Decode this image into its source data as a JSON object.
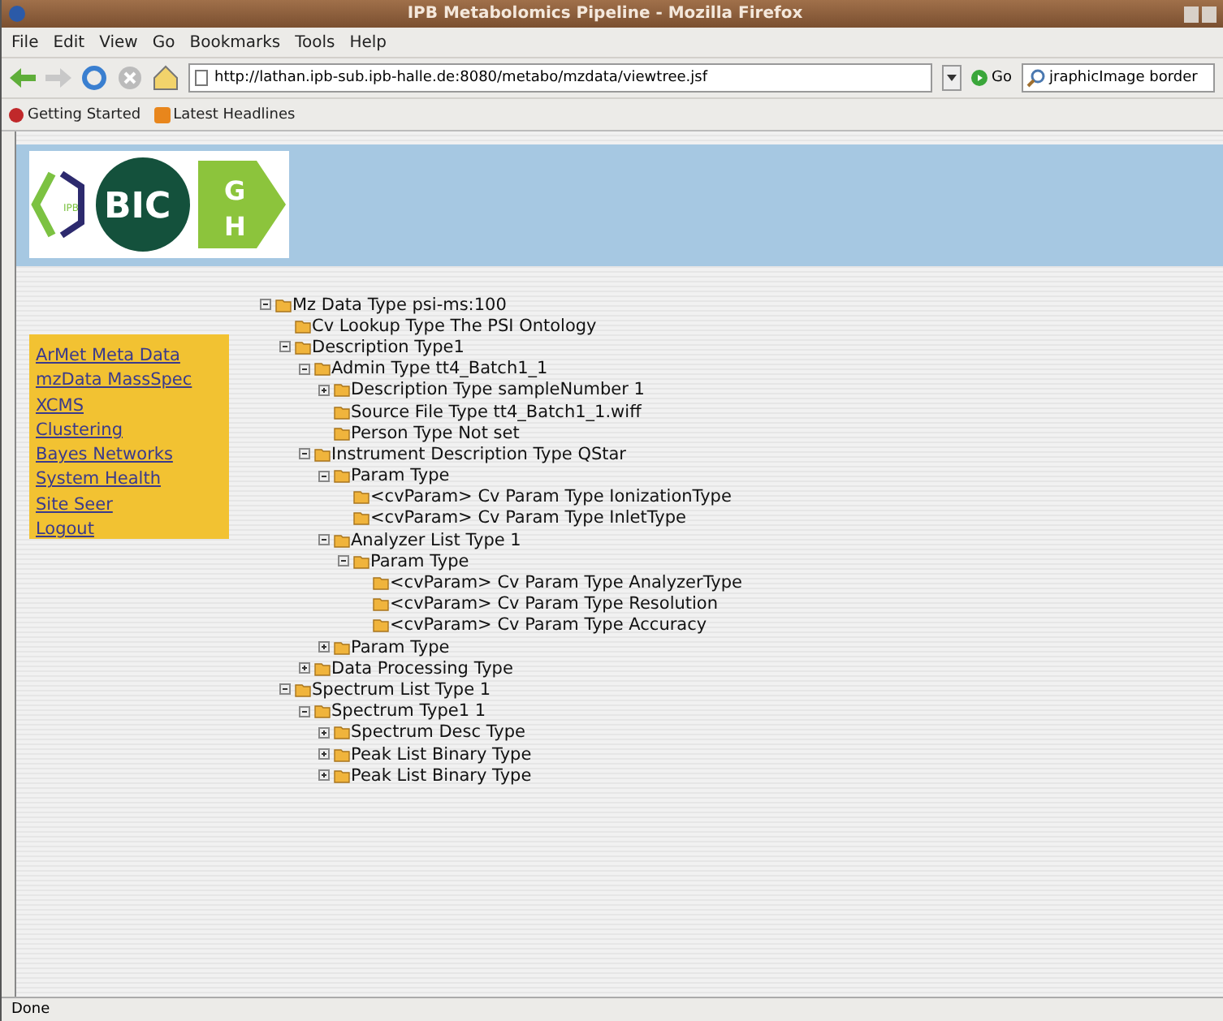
{
  "window": {
    "title": "IPB Metabolomics Pipeline - Mozilla Firefox"
  },
  "menu": [
    "File",
    "Edit",
    "View",
    "Go",
    "Bookmarks",
    "Tools",
    "Help"
  ],
  "address": {
    "value": "http://lathan.ipb-sub.ipb-halle.de:8080/metabo/mzdata/viewtree.jsf"
  },
  "go_button": "Go",
  "search": {
    "value": "jraphicImage border"
  },
  "bookmarks": [
    "Getting Started",
    "Latest Headlines"
  ],
  "logo": {
    "main": "BIC",
    "top": "G",
    "bottom": "H",
    "small": "IPB"
  },
  "nav_links": [
    "ArMet Meta Data",
    "mzData MassSpec",
    "XCMS",
    "Clustering",
    "Bayes Networks",
    "System Health",
    "Site Seer",
    "Logout"
  ],
  "tree": [
    {
      "label": "Mz Data Type psi-ms:100",
      "expanded": true,
      "children": [
        {
          "label": "Cv Lookup Type The PSI Ontology"
        },
        {
          "label": "Description Type1",
          "expanded": true,
          "children": [
            {
              "label": "Admin Type tt4_Batch1_1",
              "expanded": true,
              "children": [
                {
                  "label": "Description Type sampleNumber 1",
                  "expanded": false
                },
                {
                  "label": "Source File Type tt4_Batch1_1.wiff"
                },
                {
                  "label": "Person Type Not set"
                }
              ]
            },
            {
              "label": "Instrument Description Type QStar",
              "expanded": true,
              "children": [
                {
                  "label": "Param Type",
                  "expanded": true,
                  "children": [
                    {
                      "label": "<cvParam> Cv Param Type IonizationType"
                    },
                    {
                      "label": "<cvParam> Cv Param Type InletType"
                    }
                  ]
                },
                {
                  "label": "Analyzer List Type 1",
                  "expanded": true,
                  "children": [
                    {
                      "label": "Param Type",
                      "expanded": true,
                      "children": [
                        {
                          "label": "<cvParam> Cv Param Type AnalyzerType"
                        },
                        {
                          "label": "<cvParam> Cv Param Type Resolution"
                        },
                        {
                          "label": "<cvParam> Cv Param Type Accuracy"
                        }
                      ]
                    }
                  ]
                },
                {
                  "label": "Param Type",
                  "expanded": false
                }
              ]
            },
            {
              "label": "Data Processing Type",
              "expanded": false
            }
          ]
        },
        {
          "label": "Spectrum List Type 1",
          "expanded": true,
          "children": [
            {
              "label": "Spectrum Type1 1",
              "expanded": true,
              "children": [
                {
                  "label": "Spectrum Desc Type",
                  "expanded": false
                },
                {
                  "label": "Peak List Binary Type",
                  "expanded": false
                },
                {
                  "label": "Peak List Binary Type",
                  "expanded": false
                }
              ]
            }
          ]
        }
      ]
    }
  ],
  "status_bar": "Done"
}
